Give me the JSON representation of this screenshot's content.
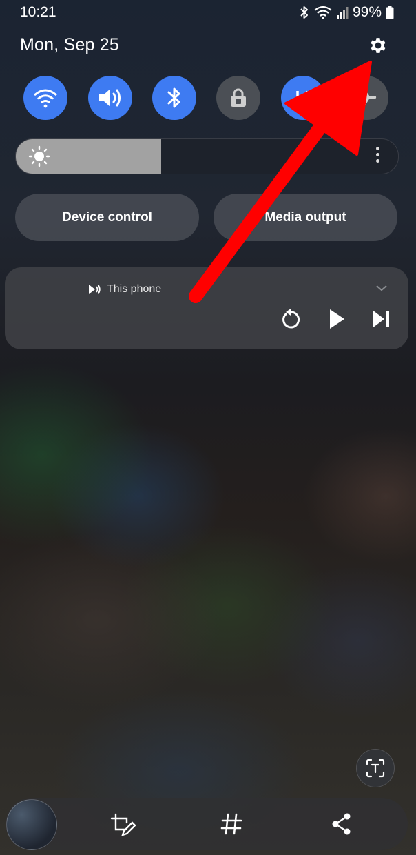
{
  "status_bar": {
    "time": "10:21",
    "battery": "99%",
    "icons": [
      "bluetooth-icon",
      "wifi-icon",
      "signal-icon",
      "battery-icon"
    ]
  },
  "header": {
    "date": "Mon, Sep 25",
    "settings_icon": "gear-icon"
  },
  "quick_tiles": [
    {
      "icon": "wifi-icon",
      "state": "on"
    },
    {
      "icon": "sound-icon",
      "state": "on"
    },
    {
      "icon": "bluetooth-icon",
      "state": "on"
    },
    {
      "icon": "lock-icon",
      "state": "off"
    },
    {
      "icon": "sync-icon",
      "state": "on"
    },
    {
      "icon": "airplane-icon",
      "state": "off"
    }
  ],
  "brightness": {
    "level": 0.38,
    "icon": "sun-icon",
    "menu_icon": "more-vertical-icon"
  },
  "buttons": {
    "device_control": "Device control",
    "media_output": "Media output"
  },
  "media": {
    "source": "This phone",
    "controls": [
      "replay-icon",
      "play-icon",
      "skip-next-icon"
    ]
  },
  "toolbar": {
    "icons": [
      "crop-edit-icon",
      "hashtag-icon",
      "share-icon"
    ],
    "extract_text_icon": "extract-text-icon"
  },
  "colors": {
    "accent_blue": "#3e7bf2",
    "tile_off": "#4b4f55",
    "annotation_arrow": "#ff0000"
  }
}
